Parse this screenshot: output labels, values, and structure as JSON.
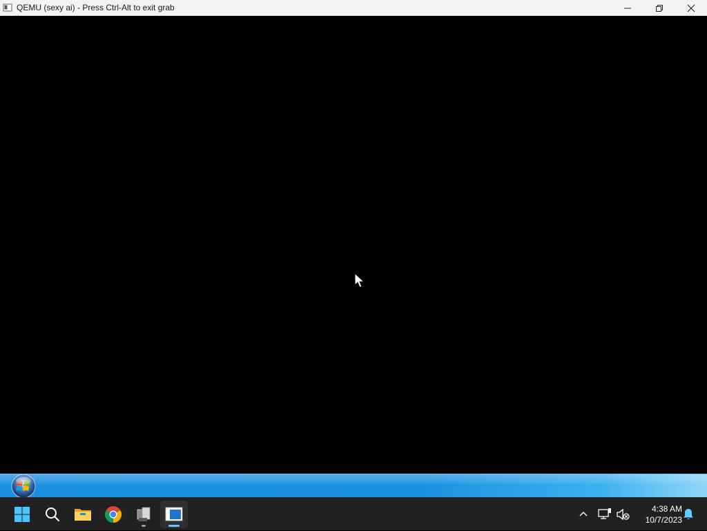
{
  "window": {
    "title": "QEMU (sexy ai) - Press Ctrl-Alt to exit grab",
    "icon": "qemu-app-icon",
    "controls": [
      "minimize-icon",
      "restore-icon",
      "close-icon"
    ]
  },
  "guest": {
    "screen_color": "#000000",
    "taskbar": {
      "start_orb": "windows-orb-icon",
      "gradient": [
        "#1c8fe0",
        "#8fd6f8"
      ]
    }
  },
  "host_taskbar": {
    "background": "#202020",
    "items": [
      {
        "name": "start-button",
        "icon": "windows-logo-icon"
      },
      {
        "name": "search-button",
        "icon": "search-icon"
      },
      {
        "name": "file-explorer-button",
        "icon": "folder-icon"
      },
      {
        "name": "chrome-button",
        "icon": "chrome-icon"
      },
      {
        "name": "app-button",
        "icon": "app-icon"
      },
      {
        "name": "qemu-taskbar-button",
        "icon": "qemu-icon",
        "active": true
      }
    ],
    "tray": {
      "icons": [
        "chevron-up-icon",
        "network-icon",
        "volume-muted-icon",
        "notification-bell-icon"
      ],
      "time": "4:38 AM",
      "date": "10/7/2023"
    },
    "accent": "#60cdff"
  }
}
